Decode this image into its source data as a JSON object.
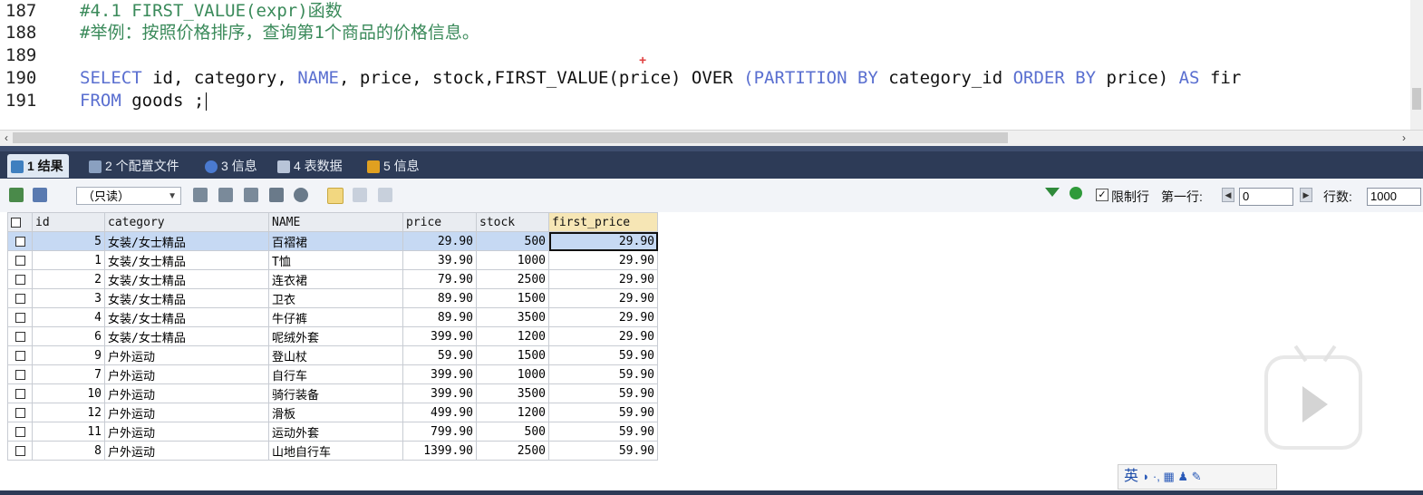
{
  "editor": {
    "lines": [
      {
        "num": "187",
        "text": "#4.1 FIRST_VALUE(expr)函数"
      },
      {
        "num": "188",
        "text": "#举例：按照价格排序，查询第1个商品的价格信息。"
      },
      {
        "num": "189",
        "text": ""
      },
      {
        "num": "190",
        "segments": [
          "SELECT",
          " id, category, ",
          "NAME",
          ", price, stock,FIRST_VALUE(price) OVER ",
          "(",
          "PARTITION BY",
          " category_id ",
          "ORDER BY",
          " price) ",
          "AS",
          " fir"
        ]
      },
      {
        "num": "191",
        "segments": [
          "FROM",
          " goods ;"
        ]
      }
    ]
  },
  "tabs": [
    {
      "label": "1 结果",
      "active": true,
      "icon": "result-grid-icon"
    },
    {
      "label": "2 个配置文件",
      "active": false,
      "icon": "profile-icon"
    },
    {
      "label": "3 信息",
      "active": false,
      "icon": "info-icon"
    },
    {
      "label": "4 表数据",
      "active": false,
      "icon": "table-data-icon"
    },
    {
      "label": "5 信息",
      "active": false,
      "icon": "info-icon"
    }
  ],
  "toolbar": {
    "mode_select": "（只读）",
    "limit_label": "限制行",
    "limit_checked": true,
    "first_row_label": "第一行:",
    "first_row_value": "0",
    "rows_label": "行数:",
    "rows_value": "1000"
  },
  "grid": {
    "columns": [
      "id",
      "category",
      "NAME",
      "price",
      "stock",
      "first_price"
    ],
    "rows": [
      [
        "5",
        "女装/女士精品",
        "百褶裙",
        "29.90",
        "500",
        "29.90"
      ],
      [
        "1",
        "女装/女士精品",
        "T恤",
        "39.90",
        "1000",
        "29.90"
      ],
      [
        "2",
        "女装/女士精品",
        "连衣裙",
        "79.90",
        "2500",
        "29.90"
      ],
      [
        "3",
        "女装/女士精品",
        "卫衣",
        "89.90",
        "1500",
        "29.90"
      ],
      [
        "4",
        "女装/女士精品",
        "牛仔裤",
        "89.90",
        "3500",
        "29.90"
      ],
      [
        "6",
        "女装/女士精品",
        "呢绒外套",
        "399.90",
        "1200",
        "29.90"
      ],
      [
        "9",
        "户外运动",
        "登山杖",
        "59.90",
        "1500",
        "59.90"
      ],
      [
        "7",
        "户外运动",
        "自行车",
        "399.90",
        "1000",
        "59.90"
      ],
      [
        "10",
        "户外运动",
        "骑行装备",
        "399.90",
        "3500",
        "59.90"
      ],
      [
        "12",
        "户外运动",
        "滑板",
        "499.90",
        "1200",
        "59.90"
      ],
      [
        "11",
        "户外运动",
        "运动外套",
        "799.90",
        "500",
        "59.90"
      ],
      [
        "8",
        "户外运动",
        "山地自行车",
        "1399.90",
        "2500",
        "59.90"
      ]
    ]
  },
  "ime": {
    "label": "英"
  },
  "colors": {
    "comment": "#3a8a5a",
    "keyword": "#5a6fd0",
    "tab_bar": "#2d3b57",
    "selected_row": "#c6d9f3"
  }
}
